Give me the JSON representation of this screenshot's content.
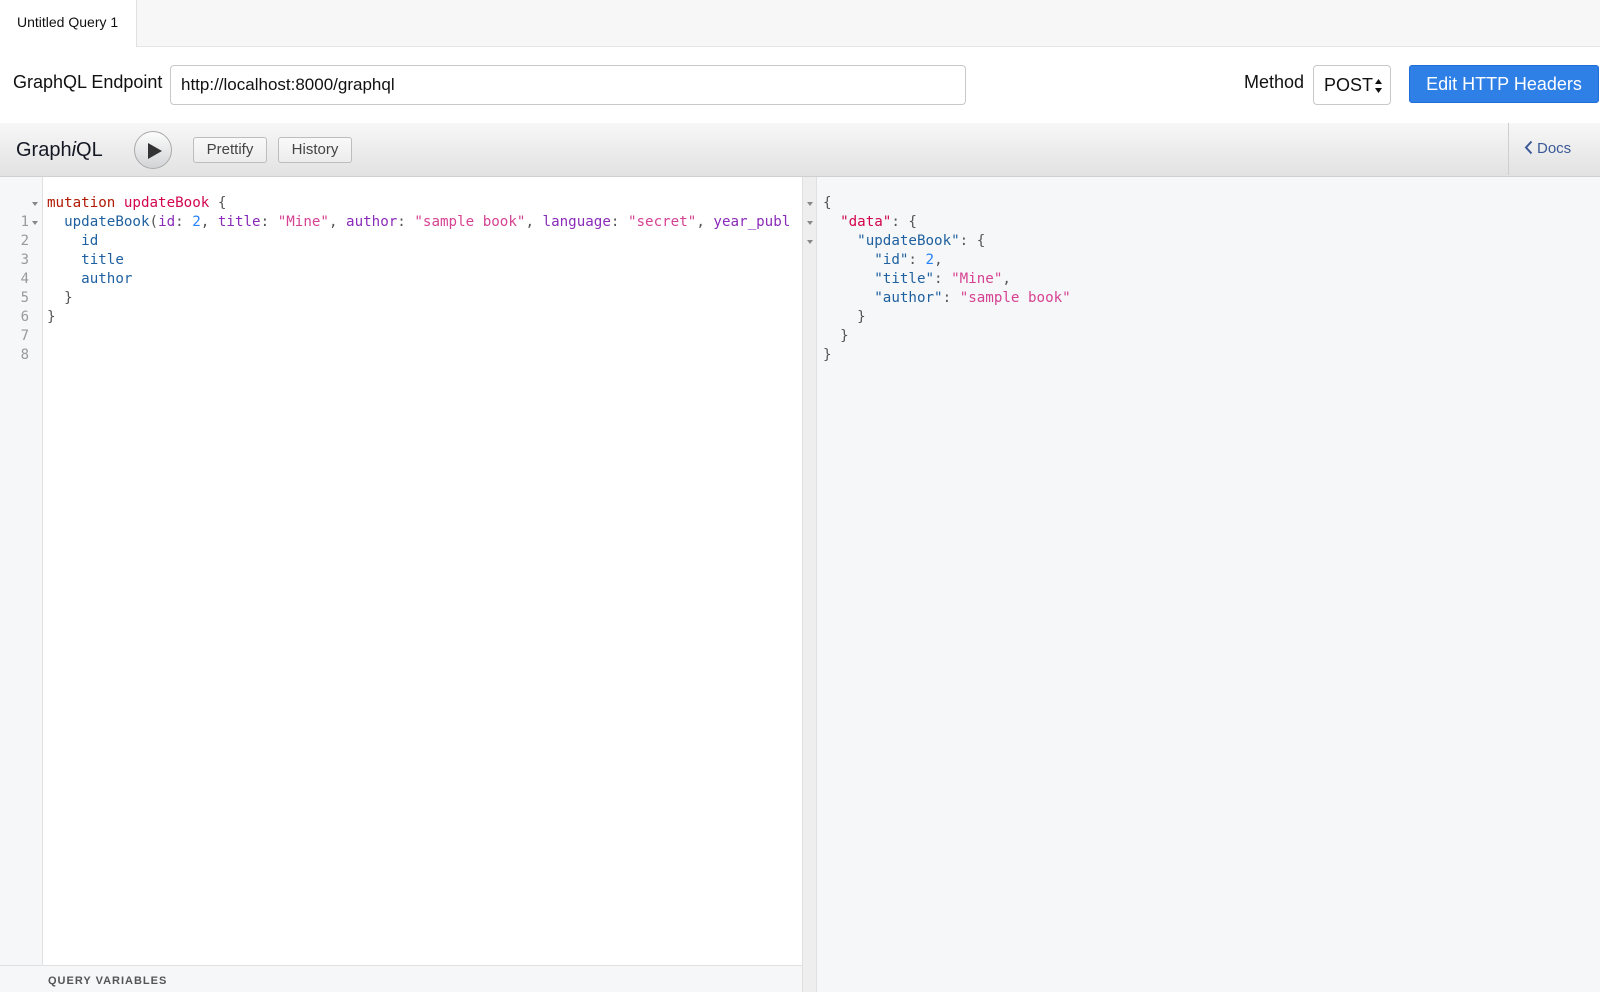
{
  "tabs": [
    {
      "label": "Untitled Query 1"
    }
  ],
  "endpoint": {
    "label": "GraphQL Endpoint",
    "value": "http://localhost:8000/graphql",
    "method_label": "Method",
    "method_value": "POST",
    "headers_button": "Edit HTTP Headers"
  },
  "toolbar": {
    "title_pre": "Graph",
    "title_i": "i",
    "title_post": "QL",
    "prettify": "Prettify",
    "history": "History",
    "docs": "Docs"
  },
  "editor": {
    "line_numbers": [
      "1",
      "2",
      "3",
      "4",
      "5",
      "6",
      "7",
      "8"
    ],
    "l1": {
      "kw": "mutation",
      "name": "updateBook",
      "brace": " {"
    },
    "l2": {
      "indent": "  ",
      "field": "updateBook",
      "open": "(",
      "a1": "id",
      "c1": ": ",
      "v1": "2",
      "s1": ", ",
      "a2": "title",
      "c2": ": ",
      "v2": "\"Mine\"",
      "s2": ", ",
      "a3": "author",
      "c3": ": ",
      "v3": "\"sample book\"",
      "s3": ", ",
      "a4": "language",
      "c4": ": ",
      "v4": "\"secret\"",
      "s4": ", ",
      "a5": "year_publ"
    },
    "l3": {
      "indent": "    ",
      "field": "id"
    },
    "l4": {
      "indent": "    ",
      "field": "title"
    },
    "l5": {
      "indent": "    ",
      "field": "author"
    },
    "l6": {
      "text": "  }"
    },
    "l7": {
      "text": "}"
    },
    "variables_label": "QUERY VARIABLES"
  },
  "result": {
    "r1": "{",
    "r2": {
      "indent": "  ",
      "key": "\"data\"",
      "rest": ": {"
    },
    "r3": {
      "indent": "    ",
      "key": "\"updateBook\"",
      "rest": ": {"
    },
    "r4": {
      "indent": "      ",
      "key": "\"id\"",
      "colon": ": ",
      "value": "2",
      "tail": ","
    },
    "r5": {
      "indent": "      ",
      "key": "\"title\"",
      "colon": ": ",
      "value": "\"Mine\"",
      "tail": ","
    },
    "r6": {
      "indent": "      ",
      "key": "\"author\"",
      "colon": ": ",
      "value": "\"sample book\""
    },
    "r7": "    }",
    "r8": "  }",
    "r9": "}"
  },
  "colors": {
    "accent_button": "#2e7fe6",
    "keyword": "#b11a04",
    "definition": "#d2054e",
    "property": "#1f61a0",
    "attribute": "#8b2bb9",
    "number": "#2882f9",
    "string": "#d64292"
  },
  "icons": [
    "play-icon",
    "select-arrows-icon",
    "chevron-left-icon",
    "fold-arrow-icon"
  ]
}
